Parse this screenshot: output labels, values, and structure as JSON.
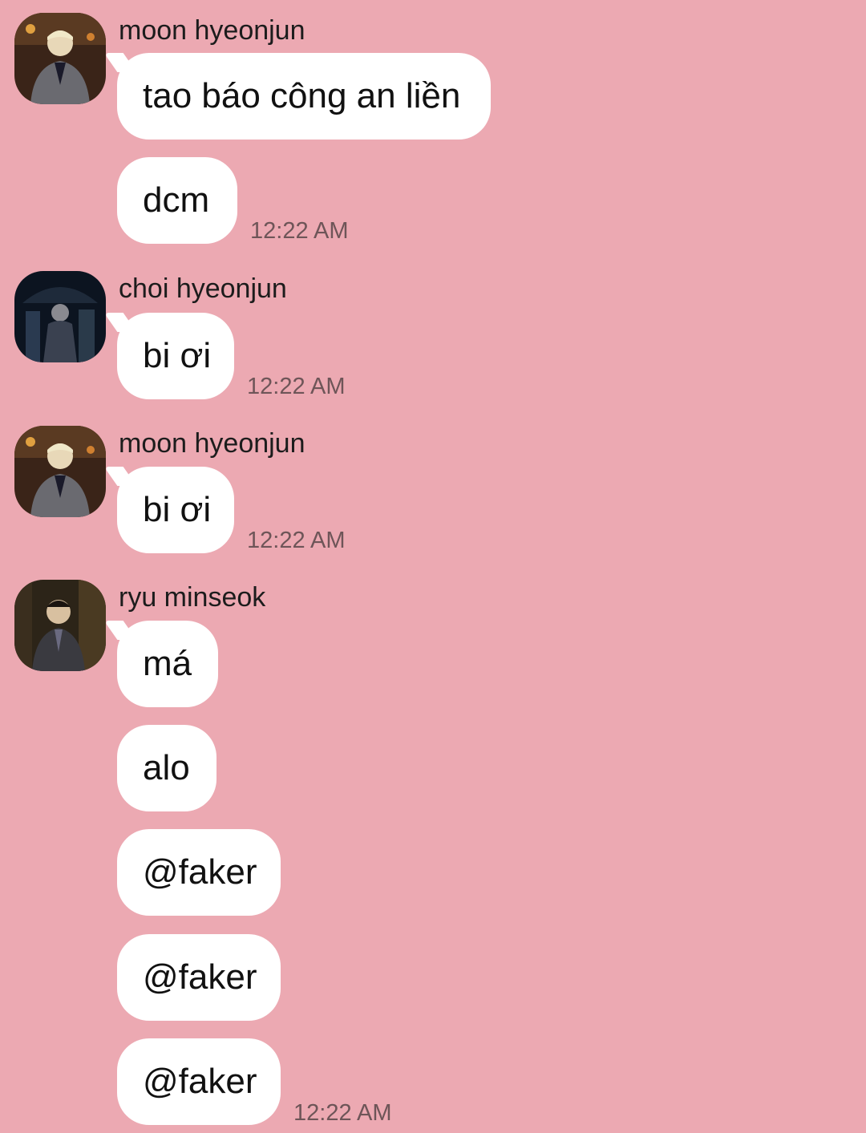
{
  "groups": [
    {
      "sender": "moon hyeonjun",
      "messages": [
        "tao báo công an liền",
        "dcm"
      ],
      "time": "12:22 AM"
    },
    {
      "sender": "choi hyeonjun",
      "messages": [
        "bi ơi"
      ],
      "time": "12:22 AM"
    },
    {
      "sender": "moon hyeonjun",
      "messages": [
        "bi ơi"
      ],
      "time": "12:22 AM"
    },
    {
      "sender": "ryu minseok",
      "messages": [
        "má",
        "alo",
        "@faker",
        "@faker",
        "@faker"
      ],
      "time": "12:22 AM"
    }
  ]
}
